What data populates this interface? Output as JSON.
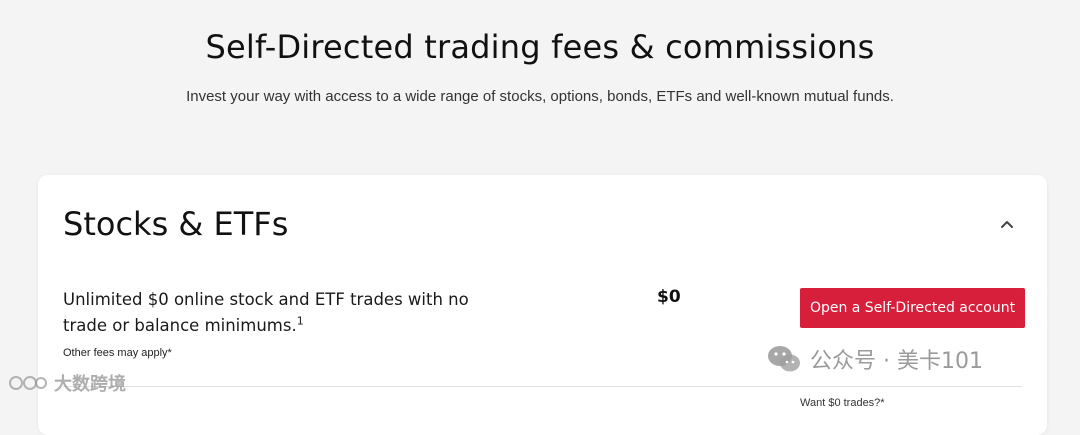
{
  "header": {
    "title": "Self-Directed trading fees & commissions",
    "subtitle": "Invest your way with access to a wide range of stocks, options, bonds, ETFs and well-known mutual funds."
  },
  "section": {
    "title": "Stocks & ETFs",
    "collapse_icon": "chevron-up-icon",
    "row": {
      "description": "Unlimited $0 online stock and ETF trades with no trade or balance minimums.",
      "footnote_marker": "1",
      "note": "Other fees may apply*",
      "price": "$0",
      "cta_label": "Open a Self-Directed account"
    },
    "next_row_peek": "Want $0 trades?*"
  },
  "watermarks": {
    "right": "公众号 · 美卡101",
    "left": "大数跨境"
  },
  "colors": {
    "accent": "#d71e3a",
    "background": "#f4f4f4",
    "card": "#ffffff"
  }
}
